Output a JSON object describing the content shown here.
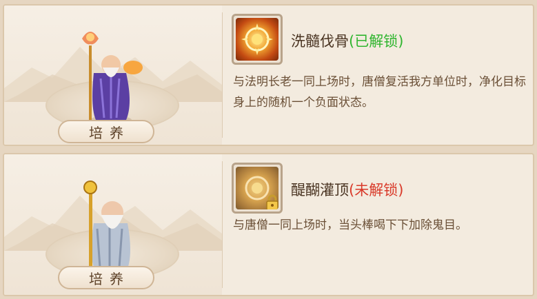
{
  "cards": [
    {
      "train_button": "培养",
      "skill": {
        "name": "洗髓伐骨",
        "status": "(已解锁)",
        "unlocked": true,
        "icon": "fire-lotus-icon",
        "description": "与法明长老一同上场时，唐僧复活我方单位时，净化目标身上的随机一个负面状态。"
      }
    },
    {
      "train_button": "培养",
      "skill": {
        "name": "醍醐灌顶",
        "status": "(未解锁)",
        "unlocked": false,
        "icon": "golden-lotus-icon",
        "description": "与唐僧一同上场时，当头棒喝下下加除鬼目。"
      }
    }
  ],
  "colors": {
    "unlocked": "#2fb52f",
    "locked": "#d93a2a"
  }
}
